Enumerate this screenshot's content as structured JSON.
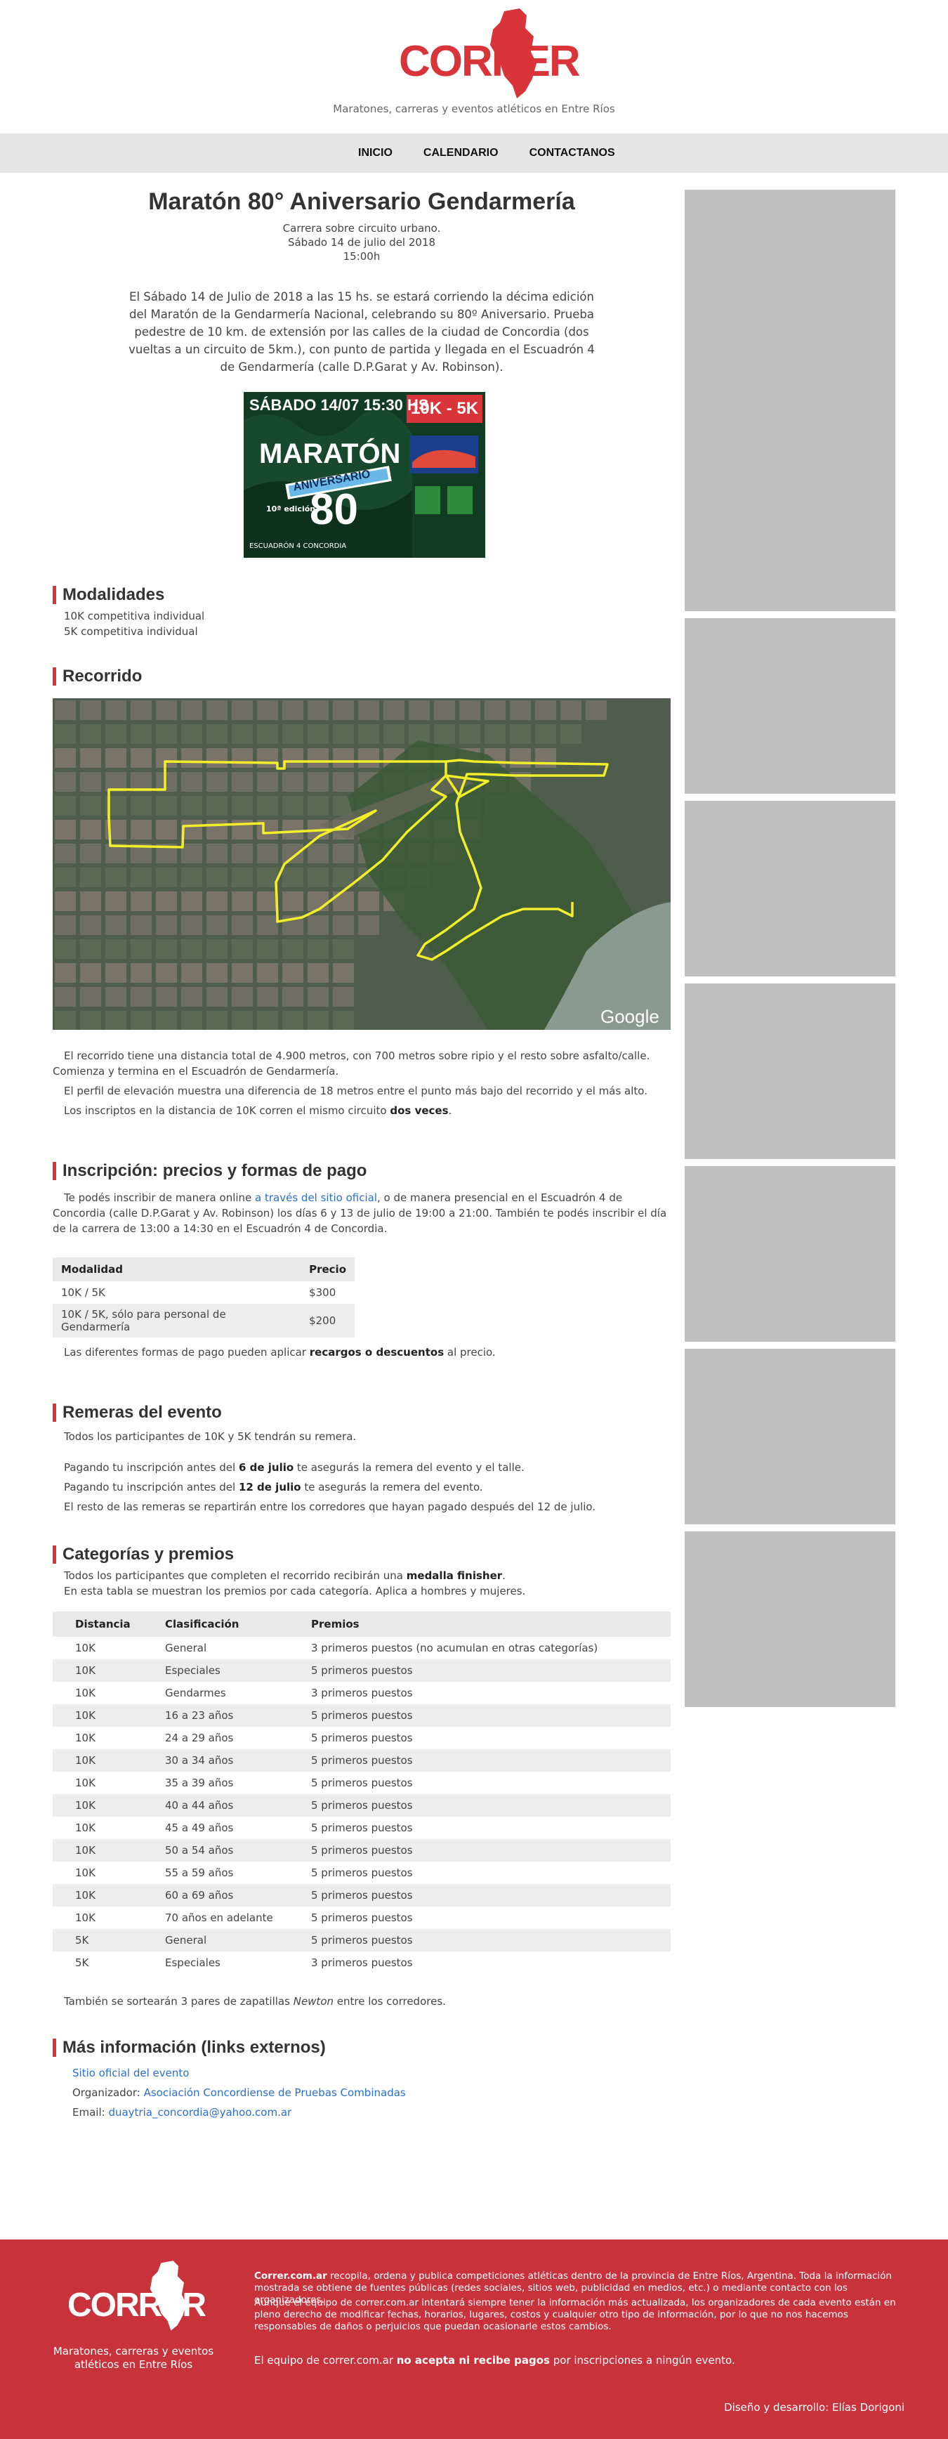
{
  "header": {
    "logo_text": "CORRER",
    "tagline": "Maratones, carreras y eventos atléticos en Entre Ríos"
  },
  "nav": {
    "items": [
      "INICIO",
      "CALENDARIO",
      "CONTACTANOS"
    ]
  },
  "event": {
    "title": "Maratón 80° Aniversario Gendarmería",
    "subtitle": "Carrera sobre circuito urbano.",
    "date": "Sábado 14 de julio del 2018",
    "time": "15:00h",
    "description": "El Sábado 14 de Julio de 2018 a las 15 hs. se estará corriendo la décima edición del Maratón de la Gendarmería Nacional, celebrando su 80º Aniversario. Prueba pedestre de 10 km. de extensión por las calles de la ciudad de Concordia (dos vueltas a un circuito de 5km.), con punto de partida y llegada en el Escuadrón 4 de Gendarmería (calle D.P.Garat y Av. Robinson)."
  },
  "poster": {
    "date_line": "SÁBADO 14/07 15:30 HS",
    "distances": "10K - 5K",
    "title": "MARATÓN",
    "ribbon": "ANIVERSARIO",
    "number": "80",
    "edition": "10ª edición",
    "organizer": "ESCUADRÓN 4 CONCORDIA"
  },
  "modalidades": {
    "heading": "Modalidades",
    "items": [
      "10K competitiva individual",
      "5K competitiva individual"
    ]
  },
  "recorrido": {
    "heading": "Recorrido",
    "map_attribution": "Google E",
    "p1": "El recorrido tiene una distancia total de 4.900 metros, con 700 metros sobre ripio y el resto sobre asfalto/calle. Comienza y termina en el Escuadrón de Gendarmería.",
    "p2": "El perfil de elevación muestra una diferencia de 18 metros entre el punto más bajo del recorrido y el más alto.",
    "p3_pre": "Los inscriptos en la distancia de 10K corren el mismo circuito ",
    "p3_bold": "dos veces",
    "p3_post": "."
  },
  "inscripcion": {
    "heading": "Inscripción: precios y formas de pago",
    "p1_pre": "Te podés inscribir de manera online ",
    "p1_link": "a través del sitio oficial",
    "p1_post": ", o de manera presencial en el Escuadrón 4 de Concordia (calle D.P.Garat y Av. Robinson) los días 6 y 13 de julio de 19:00 a 21:00. También te podés inscribir el día de la carrera de 13:00 a 14:30 en el Escuadrón 4 de Concordia.",
    "table_headers": [
      "Modalidad",
      "Precio"
    ],
    "rows": [
      [
        "10K / 5K",
        "$300"
      ],
      [
        "10K / 5K, sólo para personal de Gendarmería",
        "$200"
      ]
    ],
    "note_pre": "Las diferentes formas de pago pueden aplicar ",
    "note_bold": "recargos o descuentos",
    "note_post": " al precio."
  },
  "remeras": {
    "heading": "Remeras del evento",
    "p1": "Todos los participantes de 10K y 5K tendrán su remera.",
    "p2_pre": "Pagando tu inscripción antes del ",
    "p2_bold": "6 de julio",
    "p2_post": " te asegurás la remera del evento y el talle.",
    "p3_pre": "Pagando tu inscripción antes del ",
    "p3_bold": "12 de julio",
    "p3_post": " te asegurás la remera del evento.",
    "p4": "El resto de las remeras se repartirán entre los corredores que hayan pagado después del 12 de julio."
  },
  "categorias": {
    "heading": "Categorías y premios",
    "p1_pre": "Todos los participantes que completen el recorrido recibirán una ",
    "p1_bold": "medalla finisher",
    "p1_post": ".",
    "p2": "En esta tabla se muestran los premios por cada categoría. Aplica a hombres y mujeres.",
    "table_headers": [
      "Distancia",
      "Clasificación",
      "Premios"
    ],
    "rows": [
      [
        "10K",
        "General",
        "3 primeros puestos (no acumulan en otras categorías)"
      ],
      [
        "10K",
        "Especiales",
        "5 primeros puestos"
      ],
      [
        "10K",
        "Gendarmes",
        "3 primeros puestos"
      ],
      [
        "10K",
        "16 a 23 años",
        "5 primeros puestos"
      ],
      [
        "10K",
        "24 a 29 años",
        "5 primeros puestos"
      ],
      [
        "10K",
        "30 a 34 años",
        "5 primeros puestos"
      ],
      [
        "10K",
        "35 a 39 años",
        "5 primeros puestos"
      ],
      [
        "10K",
        "40 a 44 años",
        "5 primeros puestos"
      ],
      [
        "10K",
        "45 a 49 años",
        "5 primeros puestos"
      ],
      [
        "10K",
        "50 a 54 años",
        "5 primeros puestos"
      ],
      [
        "10K",
        "55 a 59 años",
        "5 primeros puestos"
      ],
      [
        "10K",
        "60 a 69 años",
        "5 primeros puestos"
      ],
      [
        "10K",
        "70 años en adelante",
        "5 primeros puestos"
      ],
      [
        "5K",
        "General",
        "5 primeros puestos"
      ],
      [
        "5K",
        "Especiales",
        "3 primeros puestos"
      ]
    ],
    "note_pre": "También se sortearán 3 pares de zapatillas ",
    "note_italic": "Newton",
    "note_post": " entre los corredores."
  },
  "masinfo": {
    "heading": "Más información (links externos)",
    "link1": "Sitio oficial del evento",
    "org_label": "Organizador: ",
    "org_link": "Asociación Concordiense de Pruebas Combinadas",
    "email_label": "Email: ",
    "email_link": "duaytria_concordia@yahoo.com.ar"
  },
  "footer": {
    "logo_text": "CORRER",
    "tagline": "Maratones, carreras y eventos atléticos en Entre Ríos",
    "p1_bold": "Correr.com.ar",
    "p1": " recopila, ordena y publica competiciones atléticas dentro de la provincia de Entre Ríos, Argentina. Toda la información mostrada se obtiene de fuentes públicas (redes sociales, sitios web, publicidad en medios, etc.) o mediante contacto con los organizadores.",
    "p2": "Aunque el equipo de correr.com.ar intentará siempre tener la información más actualizada, los organizadores de cada evento están en pleno derecho de modificar fechas, horarios, lugares, costos y cualquier otro tipo de información, por lo que no nos hacemos responsables de daños o perjuicios que puedan ocasionarle estos cambios.",
    "p3_pre": "El equipo de correr.com.ar ",
    "p3_bold": "no acepta ni recibe pagos",
    "p3_post": " por inscripciones a ningún evento.",
    "credit": "Diseño y desarrollo: Elías Dorigoni"
  },
  "colors": {
    "accent": "#d8343a",
    "footer_bg": "#c8323b",
    "link": "#2a6fcf",
    "route": "#f2ef2a"
  }
}
